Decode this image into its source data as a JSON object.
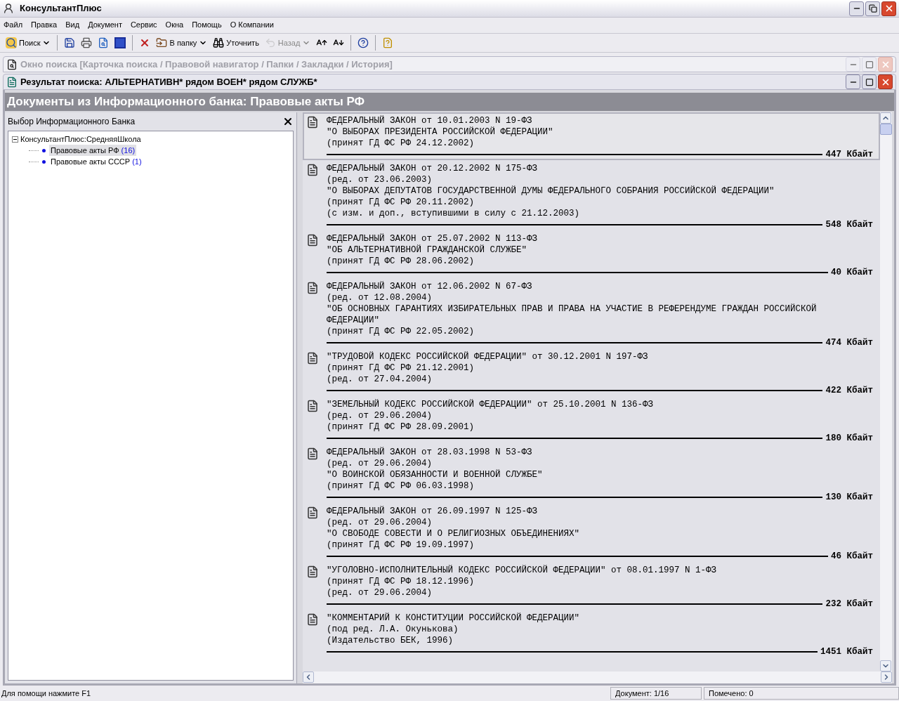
{
  "window": {
    "title": "КонсультантПлюс"
  },
  "menu": [
    {
      "label": "Файл"
    },
    {
      "label": "Правка"
    },
    {
      "label": "Вид"
    },
    {
      "label": "Документ"
    },
    {
      "label": "Сервис"
    },
    {
      "label": "Окна"
    },
    {
      "label": "Помощь"
    },
    {
      "label": "О Компании"
    }
  ],
  "toolbar": [
    {
      "kind": "button",
      "label": "Поиск",
      "dropdown": true,
      "disabled": false
    },
    {
      "kind": "separator"
    },
    {
      "kind": "button",
      "dropdown": false,
      "disabled": false
    },
    {
      "kind": "button",
      "dropdown": false,
      "disabled": false
    },
    {
      "kind": "button",
      "dropdown": false,
      "disabled": false
    },
    {
      "kind": "button",
      "dropdown": false,
      "disabled": false
    },
    {
      "kind": "separator"
    },
    {
      "kind": "button",
      "dropdown": false,
      "disabled": false
    },
    {
      "kind": "button",
      "label": "В папку",
      "dropdown": true,
      "disabled": false
    },
    {
      "kind": "button",
      "label": "Уточнить",
      "dropdown": false,
      "disabled": false
    },
    {
      "kind": "button",
      "label": "Назад",
      "dropdown": true,
      "disabled": true
    },
    {
      "kind": "button",
      "dropdown": false,
      "disabled": false
    },
    {
      "kind": "button",
      "dropdown": false,
      "disabled": false
    },
    {
      "kind": "separator"
    },
    {
      "kind": "button",
      "dropdown": false,
      "disabled": false
    },
    {
      "kind": "separator"
    },
    {
      "kind": "button",
      "dropdown": false,
      "disabled": false
    }
  ],
  "search_window": {
    "title": "Окно поиска [Карточка поиска / Правовой навигатор / Папки / Закладки / История]",
    "active": false
  },
  "result_window": {
    "title": "Результат поиска: АЛЬТЕРНАТИВН* рядом ВОЕН* рядом СЛУЖБ*",
    "active": true
  },
  "banner": "Документы из Информационного банка: Правовые акты РФ",
  "bank_panel": {
    "title": "Выбор Информационного Банка",
    "tree": {
      "label": "КонсультантПлюс:СредняяШкола",
      "expanded": true,
      "children": [
        {
          "label": "Правовые акты РФ",
          "count": "(16)",
          "selected": true
        },
        {
          "label": "Правовые акты СССР",
          "count": "(1)",
          "selected": false
        }
      ]
    }
  },
  "documents": [
    {
      "lines": [
        "ФЕДЕРАЛЬНЫЙ ЗАКОН от 10.01.2003 N 19-ФЗ",
        "\"О ВЫБОРАХ ПРЕЗИДЕНТА РОССИЙСКОЙ ФЕДЕРАЦИИ\"",
        "(принят ГД ФС РФ 24.12.2002)"
      ],
      "size": "447 Кбайт",
      "selected": true
    },
    {
      "lines": [
        "ФЕДЕРАЛЬНЫЙ ЗАКОН от 20.12.2002 N 175-ФЗ",
        "(ред. от 23.06.2003)",
        "\"О ВЫБОРАХ ДЕПУТАТОВ ГОСУДАРСТВЕННОЙ ДУМЫ ФЕДЕРАЛЬНОГО СОБРАНИЯ РОССИЙСКОЙ ФЕДЕРАЦИИ\"",
        "(принят ГД ФС РФ 20.11.2002)",
        "(с изм. и доп., вступившими в силу с 21.12.2003)"
      ],
      "size": "548 Кбайт",
      "selected": false
    },
    {
      "lines": [
        "ФЕДЕРАЛЬНЫЙ ЗАКОН от 25.07.2002 N 113-ФЗ",
        "\"ОБ АЛЬТЕРНАТИВНОЙ ГРАЖДАНСКОЙ СЛУЖБЕ\"",
        "(принят ГД ФС РФ 28.06.2002)"
      ],
      "size": "40 Кбайт",
      "selected": false
    },
    {
      "lines": [
        "ФЕДЕРАЛЬНЫЙ ЗАКОН от 12.06.2002 N 67-ФЗ",
        "(ред. от 12.08.2004)",
        "\"ОБ ОСНОВНЫХ ГАРАНТИЯХ ИЗБИРАТЕЛЬНЫХ ПРАВ И ПРАВА НА УЧАСТИЕ В РЕФЕРЕНДУМЕ ГРАЖДАН РОССИЙСКОЙ",
        "ФЕДЕРАЦИИ\"",
        "(принят ГД ФС РФ 22.05.2002)"
      ],
      "size": "474 Кбайт",
      "selected": false
    },
    {
      "lines": [
        "\"ТРУДОВОЙ КОДЕКС РОССИЙСКОЙ ФЕДЕРАЦИИ\" от 30.12.2001 N 197-ФЗ",
        "(принят ГД ФС РФ 21.12.2001)",
        "(ред. от 27.04.2004)"
      ],
      "size": "422 Кбайт",
      "selected": false
    },
    {
      "lines": [
        "\"ЗЕМЕЛЬНЫЙ КОДЕКС РОССИЙСКОЙ ФЕДЕРАЦИИ\" от 25.10.2001 N 136-ФЗ",
        "(ред. от 29.06.2004)",
        "(принят ГД ФС РФ 28.09.2001)"
      ],
      "size": "180 Кбайт",
      "selected": false
    },
    {
      "lines": [
        "ФЕДЕРАЛЬНЫЙ ЗАКОН от 28.03.1998 N 53-ФЗ",
        "(ред. от 29.06.2004)",
        "\"О ВОИНСКОЙ ОБЯЗАННОСТИ И ВОЕННОЙ СЛУЖБЕ\"",
        "(принят ГД ФС РФ 06.03.1998)"
      ],
      "size": "130 Кбайт",
      "selected": false
    },
    {
      "lines": [
        "ФЕДЕРАЛЬНЫЙ ЗАКОН от 26.09.1997 N 125-ФЗ",
        "(ред. от 29.06.2004)",
        "\"О СВОБОДЕ СОВЕСТИ И О РЕЛИГИОЗНЫХ ОБЪЕДИНЕНИЯХ\"",
        "(принят ГД ФС РФ 19.09.1997)"
      ],
      "size": "46 Кбайт",
      "selected": false
    },
    {
      "lines": [
        "\"УГОЛОВНО-ИСПОЛНИТЕЛЬНЫЙ КОДЕКС РОССИЙСКОЙ ФЕДЕРАЦИИ\" от 08.01.1997 N 1-ФЗ",
        "(принят ГД ФС РФ 18.12.1996)",
        "(ред. от 29.06.2004)"
      ],
      "size": "232 Кбайт",
      "selected": false
    },
    {
      "lines": [
        "\"КОММЕНТАРИЙ К КОНСТИТУЦИИ РОССИЙСКОЙ ФЕДЕРАЦИИ\"",
        "(под ред. Л.А. Окунькова)",
        "(Издательство БЕК, 1996)"
      ],
      "size": "1451 Кбайт",
      "selected": false
    }
  ],
  "status_bar": {
    "help": "Для помощи нажмите F1",
    "document": "Документ: 1/16",
    "marked": "Помечено: 0"
  }
}
